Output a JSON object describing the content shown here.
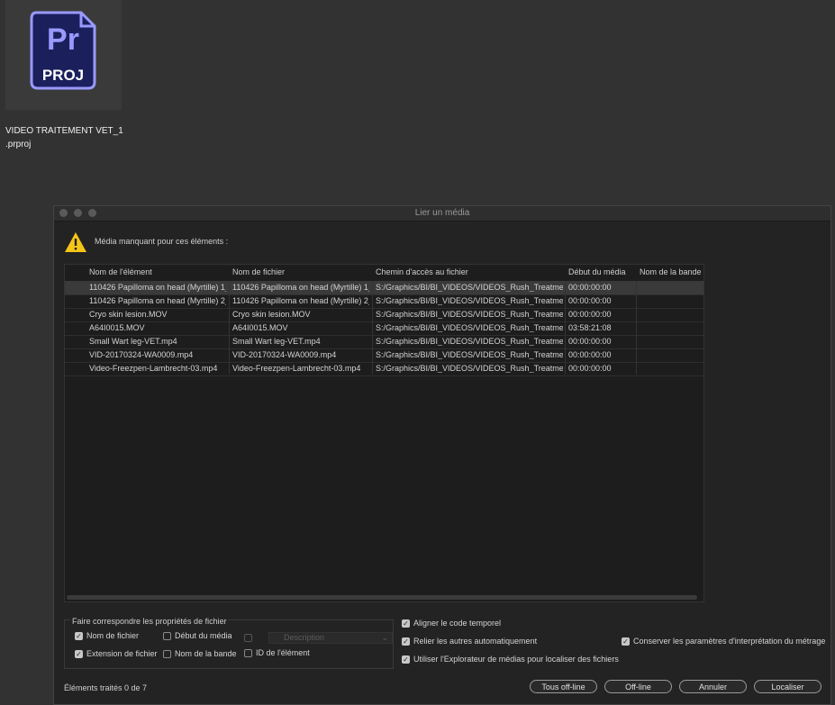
{
  "desktop": {
    "icon_name": "premiere-project-icon",
    "badge_top": "Pr",
    "badge_bottom": "PROJ",
    "filename_line1": "VIDEO TRAITEMENT VET_1",
    "filename_line2": ".prproj",
    "badge_color": "#1b1f5c",
    "badge_accent": "#9999ff"
  },
  "dialog": {
    "title": "Lier un média",
    "warning_text": "Média manquant pour ces éléments :",
    "columns": [
      "Nom de l'élément",
      "Nom de fichier",
      "Chemin d'accès au fichier",
      "Début du média",
      "Nom de la bande"
    ],
    "rows": [
      [
        "110426 Papilloma on head (Myrtille) 1_",
        "110426 Papilloma on head (Myrtille) 1_",
        "S:/Graphics/BI/BI_VIDEOS/VIDEOS_Rush_Treatments/",
        "00:00:00:00",
        ""
      ],
      [
        "110426 Papilloma on head (Myrtille) 2_",
        "110426 Papilloma on head (Myrtille) 2_",
        "S:/Graphics/BI/BI_VIDEOS/VIDEOS_Rush_Treatments/",
        "00:00:00:00",
        ""
      ],
      [
        "Cryo skin lesion.MOV",
        "Cryo skin lesion.MOV",
        "S:/Graphics/BI/BI_VIDEOS/VIDEOS_Rush_Treatments/",
        "00:00:00:00",
        ""
      ],
      [
        "A64I0015.MOV",
        "A64I0015.MOV",
        "S:/Graphics/BI/BI_VIDEOS/VIDEOS_Rush_Treatments/",
        "03:58:21:08",
        ""
      ],
      [
        "Small Wart leg-VET.mp4",
        "Small Wart leg-VET.mp4",
        "S:/Graphics/BI/BI_VIDEOS/VIDEOS_Rush_Treatments/",
        "00:00:00:00",
        ""
      ],
      [
        "VID-20170324-WA0009.mp4",
        "VID-20170324-WA0009.mp4",
        "S:/Graphics/BI/BI_VIDEOS/VIDEOS_Rush_Treatments/",
        "00:00:00:00",
        ""
      ],
      [
        "Video-Freezpen-Lambrecht-03.mp4",
        "Video-Freezpen-Lambrecht-03.mp4",
        "S:/Graphics/BI/BI_VIDEOS/VIDEOS_Rush_Treatments/",
        "00:00:00:00",
        ""
      ]
    ],
    "match_group": {
      "title": "Faire correspondre les propriétés de fichier",
      "file_name": "Nom de fichier",
      "media_start": "Début du média",
      "description": "Description",
      "file_extension": "Extension de fichier",
      "tape_name": "Nom de la bande",
      "clip_id": "ID de l'élément"
    },
    "options": {
      "align_timecode": "Aligner le code temporel",
      "relink_others": "Relier les autres automatiquement",
      "use_media_browser": "Utiliser l'Explorateur de médias pour localiser des fichiers",
      "preserve_interpret": "Conserver les paramètres d'interprétation du métrage"
    },
    "status": "Éléments traités 0 de 7",
    "buttons": {
      "offline_all": "Tous off-line",
      "offline": "Off-line",
      "cancel": "Annuler",
      "locate": "Localiser"
    },
    "warning_color": "#f5c518"
  }
}
